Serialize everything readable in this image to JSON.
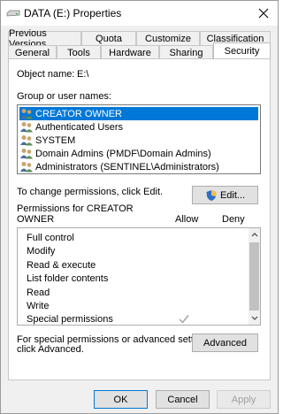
{
  "window": {
    "title": "DATA (E:) Properties",
    "icon": "drive-icon",
    "close_icon": "close-icon"
  },
  "tabs": {
    "row1": [
      "Previous Versions",
      "Quota",
      "Customize",
      "Classification"
    ],
    "row2": [
      "General",
      "Tools",
      "Hardware",
      "Sharing",
      "Security"
    ],
    "active": "Security"
  },
  "security": {
    "object_name_label": "Object name:",
    "object_name_value": "E:\\",
    "group_label": "Group or user names:",
    "users": [
      {
        "name": "CREATOR OWNER",
        "selected": true
      },
      {
        "name": "Authenticated Users",
        "selected": false
      },
      {
        "name": "SYSTEM",
        "selected": false
      },
      {
        "name": "Domain Admins (PMDF\\Domain Admins)",
        "selected": false
      },
      {
        "name": "Administrators (SENTINEL\\Administrators)",
        "selected": false
      }
    ],
    "change_text": "To change permissions, click Edit.",
    "edit_label": "Edit...",
    "permissions_for_line1": "Permissions for CREATOR",
    "permissions_for_line2": "OWNER",
    "allow_header": "Allow",
    "deny_header": "Deny",
    "permissions": [
      {
        "name": "Full control",
        "allow": false,
        "deny": false
      },
      {
        "name": "Modify",
        "allow": false,
        "deny": false
      },
      {
        "name": "Read & execute",
        "allow": false,
        "deny": false
      },
      {
        "name": "List folder contents",
        "allow": false,
        "deny": false
      },
      {
        "name": "Read",
        "allow": false,
        "deny": false
      },
      {
        "name": "Write",
        "allow": false,
        "deny": false
      },
      {
        "name": "Special permissions",
        "allow": true,
        "deny": false
      }
    ],
    "advanced_text_line1": "For special permissions or advanced settings,",
    "advanced_text_line2": "click Advanced.",
    "advanced_label": "Advanced"
  },
  "footer": {
    "ok": "OK",
    "cancel": "Cancel",
    "apply": "Apply"
  },
  "colors": {
    "selection": "#0078d7",
    "check": "#a0a0a0"
  }
}
